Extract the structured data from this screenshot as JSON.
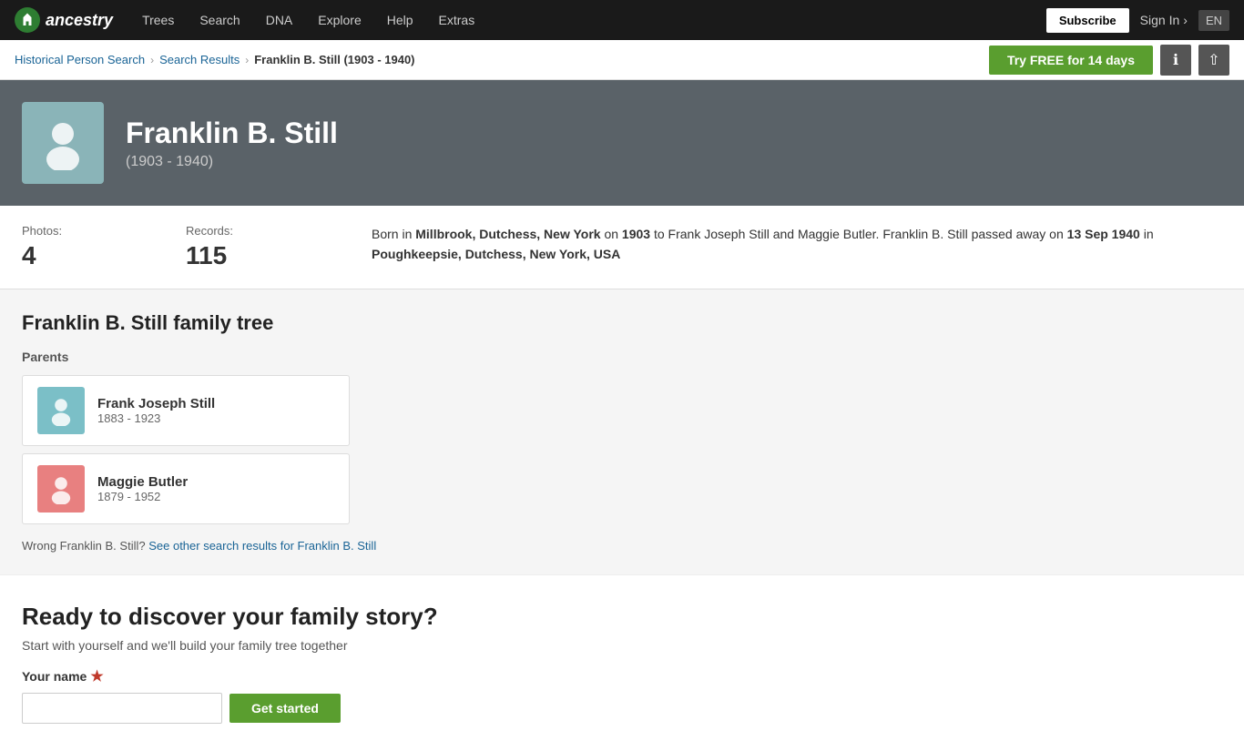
{
  "nav": {
    "logo_text": "ancestry",
    "items": [
      "Trees",
      "Search",
      "DNA",
      "Explore",
      "Help",
      "Extras"
    ],
    "subscribe_label": "Subscribe",
    "signin_label": "Sign In",
    "signin_arrow": "›",
    "lang_label": "EN"
  },
  "breadcrumb": {
    "historical": "Historical Person Search",
    "search_results": "Search Results",
    "current": "Franklin B. Still (1903 - 1940)",
    "try_free_label": "Try FREE for 14 days"
  },
  "hero": {
    "name": "Franklin B. Still",
    "years": "(1903 - 1940)"
  },
  "stats": {
    "photos_label": "Photos:",
    "photos_value": "4",
    "records_label": "Records:",
    "records_value": "115",
    "bio": "Born in Millbrook, Dutchess, New York on 1903 to Frank Joseph Still and Maggie Butler. Franklin B. Still passed away on 13 Sep 1940 in Poughkeepsie, Dutchess, New York, USA.",
    "bio_parts": {
      "born_location": "Millbrook, Dutchess, New York",
      "born_year": "1903",
      "death_date": "13 Sep 1940",
      "death_location": "Poughkeepsie, Dutchess, New York, USA"
    }
  },
  "family_tree": {
    "section_title": "Franklin B. Still family tree",
    "parents_label": "Parents",
    "parents": [
      {
        "name": "Frank Joseph Still",
        "years": "1883 - 1923",
        "gender": "male"
      },
      {
        "name": "Maggie Butler",
        "years": "1879 - 1952",
        "gender": "female"
      }
    ],
    "wrong_text": "Wrong Franklin B. Still?",
    "wrong_link": "See other search results for Franklin B. Still"
  },
  "cta": {
    "title": "Ready to discover your family story?",
    "subtitle": "Start with yourself and we'll build your family tree together",
    "name_label": "Your name",
    "name_placeholder": "",
    "submit_label": "Get started"
  }
}
